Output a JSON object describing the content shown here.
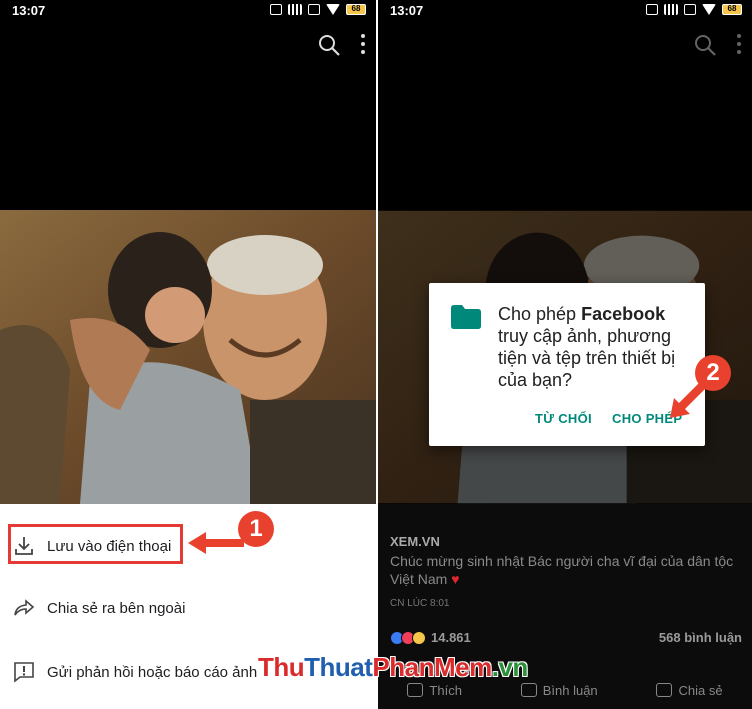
{
  "left_screen": {
    "status": {
      "time": "13:07",
      "battery": "68"
    },
    "menu": {
      "save_label": "Lưu vào điện thoại",
      "share_label": "Chia sẻ ra bên ngoài",
      "report_label": "Gửi phản hồi hoặc báo cáo ảnh"
    },
    "step_marker": "1"
  },
  "right_screen": {
    "status": {
      "time": "13:07",
      "battery": "68"
    },
    "dialog": {
      "message_prefix": "Cho phép ",
      "app_name": "Facebook",
      "message_suffix": " truy cập ảnh, phương tiện và tệp trên thiết bị của bạn?",
      "deny_label": "TỪ CHỐI",
      "allow_label": "CHO PHÉP"
    },
    "step_marker": "2",
    "post": {
      "source": "XEM.VN",
      "caption": "Chúc mừng sinh nhật Bác người cha vĩ đại của dân tộc Việt Nam",
      "heart": "♥",
      "time": "CN LÚC 8:01",
      "reaction_count": "14.861",
      "comment_count": "568 bình luận",
      "like_label": "Thích",
      "comment_label": "Bình luận",
      "share_label": "Chia sẻ"
    }
  },
  "watermark": {
    "part1": "Thu",
    "part2": "Thuat",
    "part3": "PhanMem",
    "part4": ".vn"
  },
  "colors": {
    "highlight": "#e53935",
    "marker": "#e8412e",
    "dialog_button": "#00897b",
    "folder": "#00897b"
  }
}
